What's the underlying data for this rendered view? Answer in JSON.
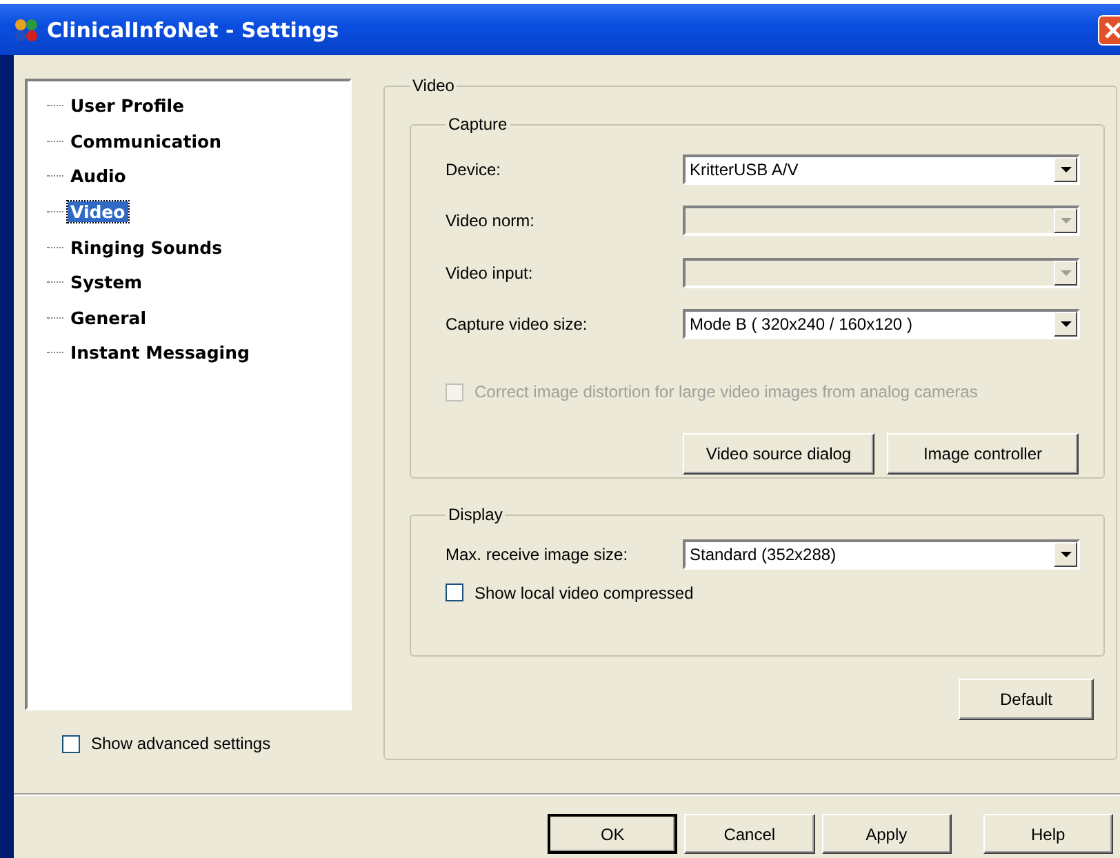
{
  "window": {
    "title": "ClinicalInfoNet - Settings"
  },
  "sidebar": {
    "items": [
      {
        "label": "User Profile",
        "selected": false
      },
      {
        "label": "Communication",
        "selected": false
      },
      {
        "label": "Audio",
        "selected": false
      },
      {
        "label": "Video",
        "selected": true
      },
      {
        "label": "Ringing Sounds",
        "selected": false
      },
      {
        "label": "System",
        "selected": false
      },
      {
        "label": "General",
        "selected": false
      },
      {
        "label": "Instant Messaging",
        "selected": false
      }
    ],
    "advanced": {
      "label": "Show advanced settings",
      "checked": false
    }
  },
  "video": {
    "title": "Video",
    "capture": {
      "title": "Capture",
      "fields": [
        {
          "label": "Device:",
          "value": "KritterUSB A/V",
          "disabled": false
        },
        {
          "label": "Video norm:",
          "disabled": true
        },
        {
          "label": "Video input:",
          "disabled": true
        },
        {
          "label": "Capture video size:",
          "value": "Mode B ( 320x240 / 160x120 )",
          "disabled": false
        }
      ],
      "distortion": {
        "label": "Correct image distortion for large video images from analog cameras",
        "checked": false,
        "disabled": true
      },
      "buttons": [
        "Video source dialog",
        "Image controller"
      ]
    },
    "display": {
      "title": "Display",
      "fields": [
        {
          "label": "Max. receive image size:",
          "value": "Standard (352x288)",
          "disabled": false
        }
      ],
      "compressed": {
        "label": "Show local video compressed",
        "checked": false,
        "disabled": false
      }
    },
    "default_button": "Default"
  },
  "buttons": [
    {
      "label": "OK",
      "default": true
    },
    {
      "label": "Cancel",
      "default": false
    },
    {
      "label": "Apply",
      "default": false
    },
    {
      "label": "Help",
      "default": false
    }
  ]
}
